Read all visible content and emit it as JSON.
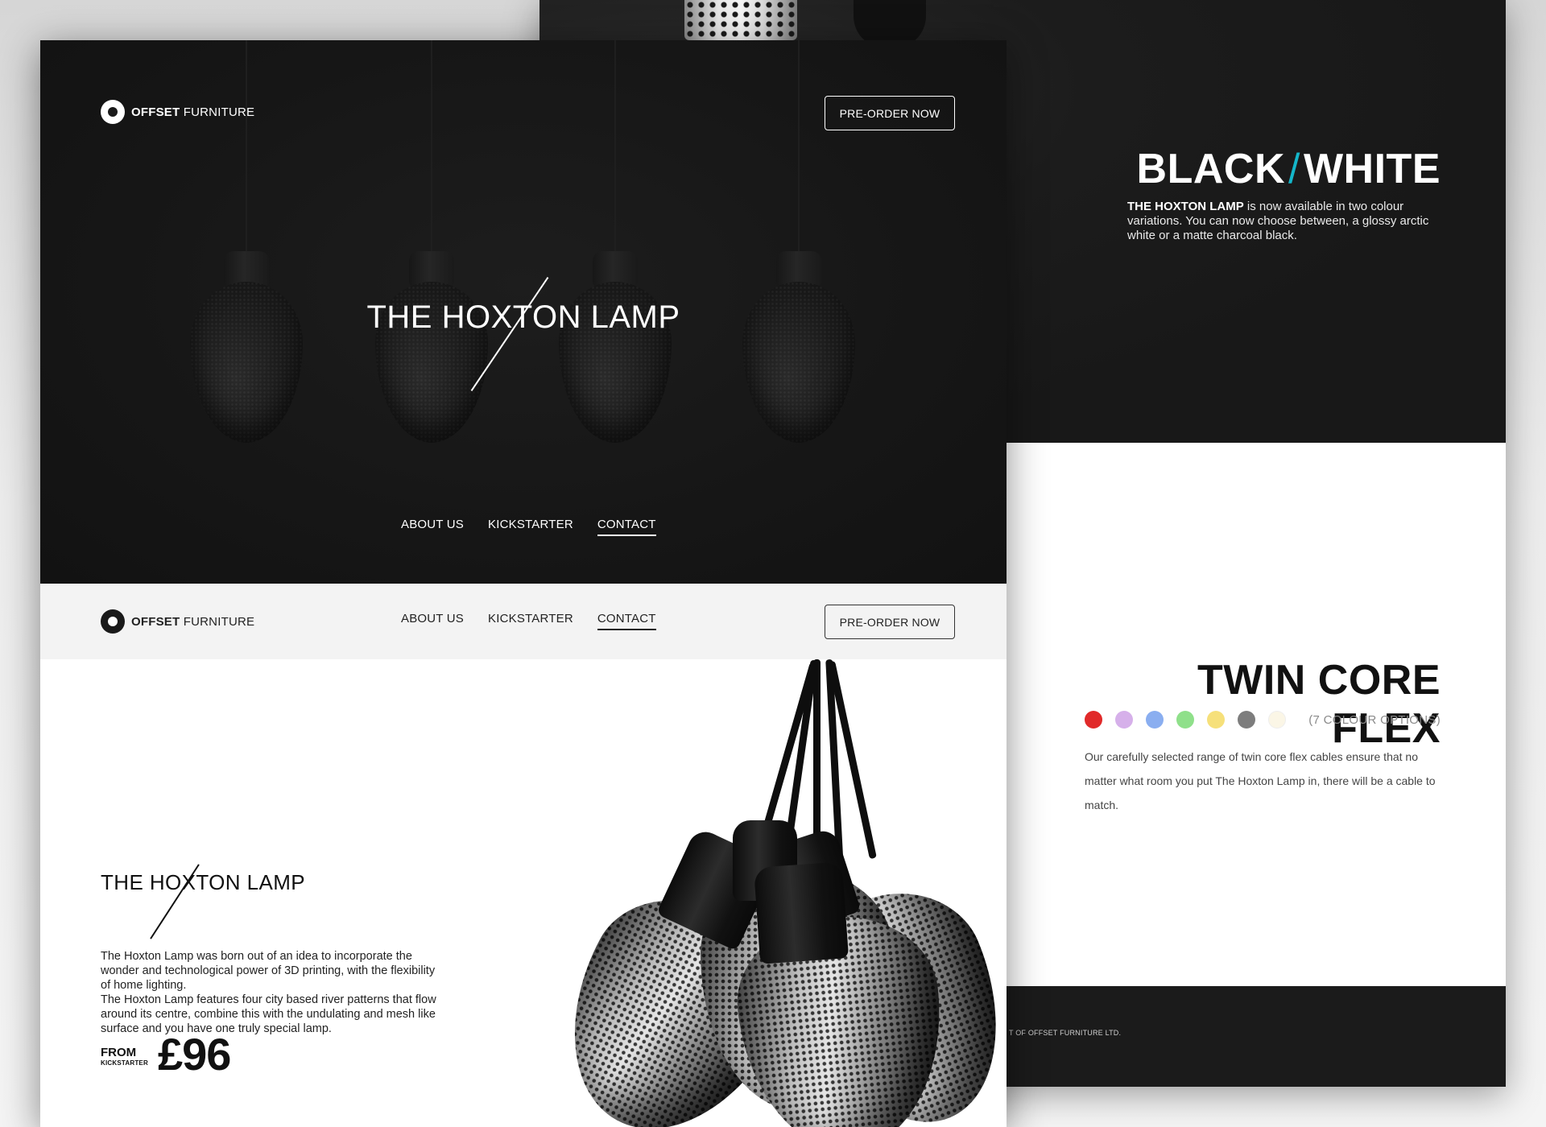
{
  "brand": {
    "name_bold": "OFFSET",
    "name_light": "FURNITURE"
  },
  "hero": {
    "title": "THE HOXTON LAMP",
    "preorder_label": "PRE-ORDER NOW",
    "nav": [
      "ABOUT US",
      "KICKSTARTER",
      "CONTACT"
    ],
    "active_nav": "CONTACT"
  },
  "header_bar": {
    "nav": [
      "ABOUT US",
      "KICKSTARTER",
      "CONTACT"
    ],
    "preorder_label": "PRE-ORDER NOW"
  },
  "product": {
    "title": "THE HOXTON LAMP",
    "description_lines": [
      "The Hoxton Lamp was born out of an idea to incorporate the wonder and technological power of 3D printing, with the flexibility of home lighting.",
      "The Hoxton Lamp features four city based river patterns that flow around its centre, combine this with the undulating and mesh like surface and you have one truly special lamp."
    ],
    "from_label": "FROM",
    "from_sub_label": "KICKSTARTER",
    "price": "£96"
  },
  "black_white": {
    "title_left": "BLACK",
    "title_slash": "/",
    "title_right": "WHITE",
    "description_lead": "THE HOXTON LAMP",
    "description_rest": " is now available in two colour variations. You can now choose between, a glossy arctic white or a matte charcoal black."
  },
  "twin_core": {
    "title": "TWIN CORE FLEX",
    "colour_options_label": "(7 COLOUR OPTIONS)",
    "swatches": [
      "#e12a2a",
      "#d6b0ea",
      "#8aaef0",
      "#8fe08a",
      "#f6e07a",
      "#7d7d7d",
      "#fbf6e6"
    ],
    "description": "Our carefully selected range of twin core flex cables ensure that no matter what room you put The Hoxton Lamp in, there will be a cable to match."
  },
  "footer": {
    "copyright_fragment": "T OF OFFSET FURNITURE LTD."
  },
  "colors": {
    "accent": "#14b6c9",
    "dark_bg": "#161616",
    "light_bar": "#f3f3f3"
  }
}
